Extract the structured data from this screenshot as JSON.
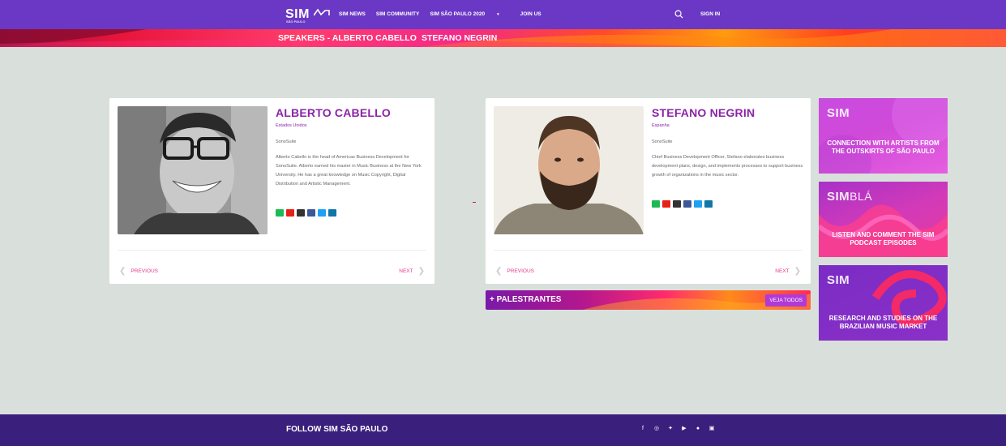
{
  "nav": {
    "logo": "SIM",
    "logo_sub": "SÃO PAULO",
    "links": [
      "SIM NEWS",
      "SIM COMMUNITY",
      "SIM SÃO PAULO 2020",
      "JOIN US"
    ],
    "signin": "SIGN IN"
  },
  "banner": {
    "prefix": "SPEAKERS - ALBERTO CABELLO",
    "suffix": "STEFANO NEGRIN"
  },
  "speakers": [
    {
      "name": "ALBERTO CABELLO",
      "country": "Estados Unidos",
      "company": "SonoSuite",
      "bio": "Alberto Cabello is the head of Americas Business Development for SonoSuite. Alberto earned his master in Music Business at the New York University. He has a great knowledge on Music Copyright, Digital Distribution and Artistic Management.",
      "prev": "PREVIOUS",
      "next": "NEXT"
    },
    {
      "name": "STEFANO NEGRIN",
      "country": "Espanha",
      "company": "SonoSuite",
      "bio": "Chief Business Development Officer, Stefano elaborates business development plans, design, and implements processes to support business growth of organizations in the music sector.",
      "prev": "PREVIOUS",
      "next": "NEXT"
    }
  ],
  "palestrantes": {
    "label": "+ PALESTRANTES",
    "button": "VEJA TODOS"
  },
  "ads": [
    {
      "logo": "SIM",
      "text": "CONNECTION WITH ARTISTS FROM THE OUTSKIRTS OF SÃO PAULO"
    },
    {
      "logo": "SIM",
      "logo_extra": "BLÁ",
      "text": "LISTEN AND COMMENT THE SIM PODCAST EPISODES"
    },
    {
      "logo": "SIM",
      "text": "RESEARCH AND STUDIES ON THE BRAZILIAN MUSIC MARKET"
    }
  ],
  "footer": {
    "title": "FOLLOW SIM SÃO PAULO",
    "icons": [
      "facebook-icon",
      "instagram-icon",
      "twitter-icon",
      "youtube-icon",
      "spotify-icon",
      "linkedin-icon"
    ]
  },
  "colors": {
    "nav": "#6a38c4",
    "name": "#8b24a6",
    "link": "#e4398b",
    "footer": "#3a1f7d"
  }
}
